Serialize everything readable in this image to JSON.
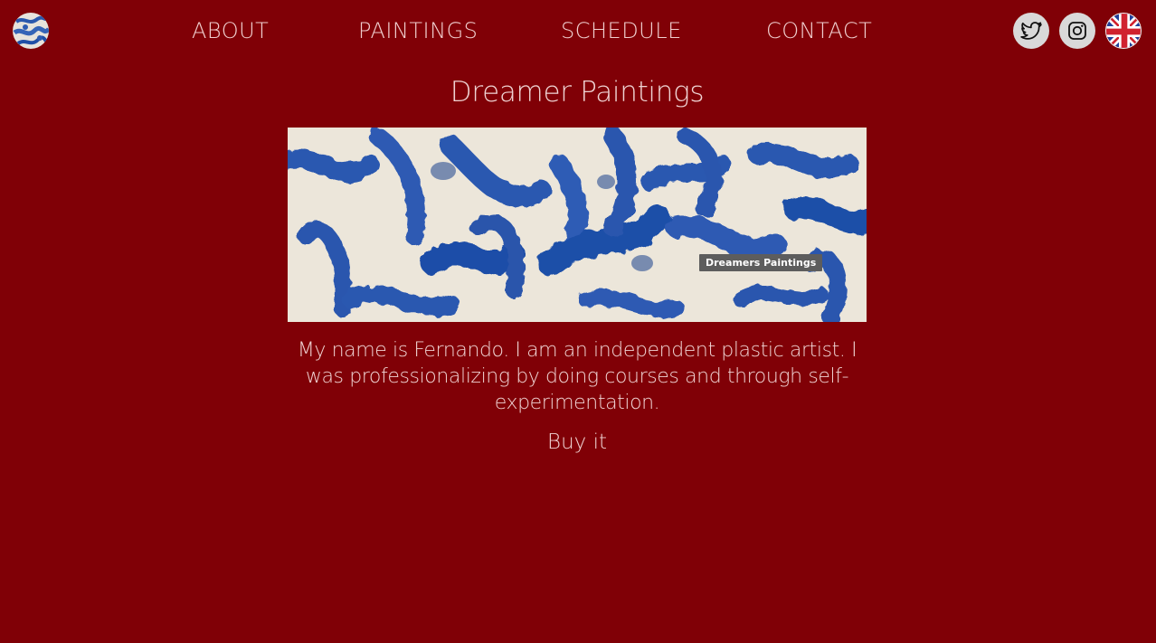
{
  "header": {
    "nav": [
      {
        "label": "ABOUT"
      },
      {
        "label": "PAINTINGS"
      },
      {
        "label": "SCHEDULE"
      },
      {
        "label": "CONTACT"
      }
    ],
    "social": [
      "twitter-icon",
      "instagram-icon"
    ],
    "language_icon": "uk-flag-icon"
  },
  "main": {
    "title": "Dreamer Paintings",
    "banner_tooltip": "Dreamers Paintings",
    "description": "My name is Fernando. I am an independent plastic artist. I was professionalizing by doing courses and through self-experimentation.",
    "buy_label": "Buy it"
  },
  "colors": {
    "background": "#800006",
    "text": "#efd3d3",
    "icon_bg": "#d9d9d9",
    "brush_blue": "#2353b3",
    "canvas": "#eae3d6"
  }
}
